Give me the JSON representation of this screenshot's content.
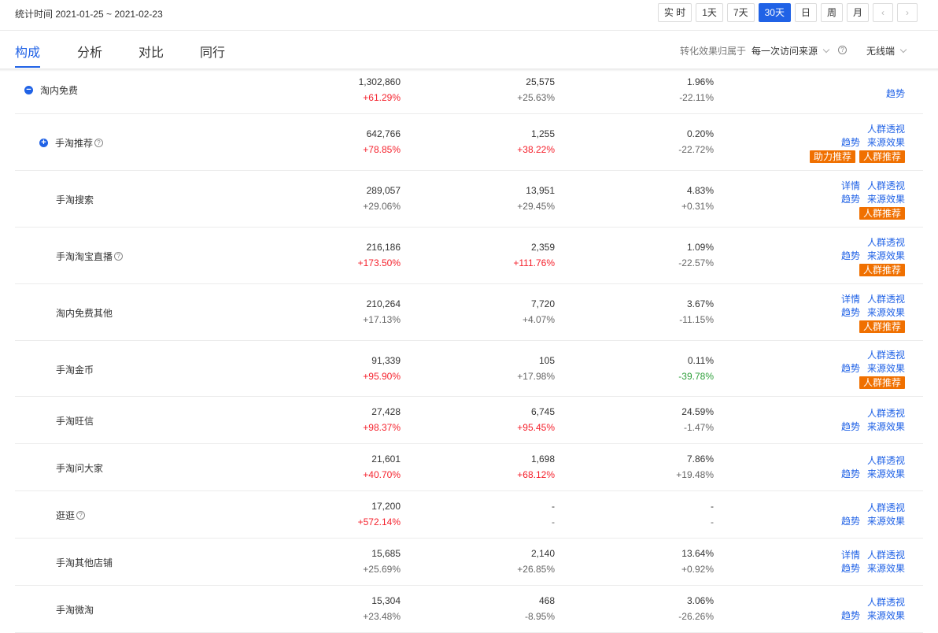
{
  "header": {
    "stat_time": "统计时间 2021-01-25 ~ 2021-02-23",
    "periods": [
      "实 时",
      "1天",
      "7天",
      "30天",
      "日",
      "周",
      "月"
    ],
    "active_period": "30天",
    "prev_glyph": "‹",
    "next_glyph": "›"
  },
  "tabs": [
    {
      "label": "构成",
      "active": true
    },
    {
      "label": "分析",
      "active": false
    },
    {
      "label": "对比",
      "active": false
    },
    {
      "label": "同行",
      "active": false
    }
  ],
  "filters": {
    "attribution_label": "转化效果归属于",
    "attribution_value": "每一次访问来源",
    "device_value": "无线端"
  },
  "colors": {
    "accent": "#2062e6",
    "badge": "#f07000",
    "up": "#f5222d",
    "down": "#2e9f3a"
  },
  "rows": [
    {
      "name": "淘内免费",
      "icon": "minus",
      "help": false,
      "level": 0,
      "c1": {
        "v": "1,302,860",
        "c": "+61.29%",
        "t": "up"
      },
      "c2": {
        "v": "25,575",
        "c": "+25.63%",
        "t": "neutral"
      },
      "c3": {
        "v": "1.96%",
        "c": "-22.11%",
        "t": "neutral"
      },
      "links": [
        [
          "趋势"
        ]
      ],
      "badges": []
    },
    {
      "name": "手淘推荐",
      "icon": "plus",
      "help": true,
      "level": 1,
      "c1": {
        "v": "642,766",
        "c": "+78.85%",
        "t": "up"
      },
      "c2": {
        "v": "1,255",
        "c": "+38.22%",
        "t": "up"
      },
      "c3": {
        "v": "0.20%",
        "c": "-22.72%",
        "t": "neutral"
      },
      "links": [
        [
          "人群透视"
        ],
        [
          "趋势",
          "来源效果"
        ]
      ],
      "badges": [
        "助力推荐",
        "人群推荐"
      ]
    },
    {
      "name": "手淘搜索",
      "icon": "",
      "help": false,
      "level": 2,
      "c1": {
        "v": "289,057",
        "c": "+29.06%",
        "t": "neutral"
      },
      "c2": {
        "v": "13,951",
        "c": "+29.45%",
        "t": "neutral"
      },
      "c3": {
        "v": "4.83%",
        "c": "+0.31%",
        "t": "neutral"
      },
      "links": [
        [
          "详情",
          "人群透视"
        ],
        [
          "趋势",
          "来源效果"
        ]
      ],
      "badges": [
        "人群推荐"
      ]
    },
    {
      "name": "手淘淘宝直播",
      "icon": "",
      "help": true,
      "level": 2,
      "c1": {
        "v": "216,186",
        "c": "+173.50%",
        "t": "up"
      },
      "c2": {
        "v": "2,359",
        "c": "+111.76%",
        "t": "up"
      },
      "c3": {
        "v": "1.09%",
        "c": "-22.57%",
        "t": "neutral"
      },
      "links": [
        [
          "人群透视"
        ],
        [
          "趋势",
          "来源效果"
        ]
      ],
      "badges": [
        "人群推荐"
      ]
    },
    {
      "name": "淘内免费其他",
      "icon": "",
      "help": false,
      "level": 2,
      "c1": {
        "v": "210,264",
        "c": "+17.13%",
        "t": "neutral"
      },
      "c2": {
        "v": "7,720",
        "c": "+4.07%",
        "t": "neutral"
      },
      "c3": {
        "v": "3.67%",
        "c": "-11.15%",
        "t": "neutral"
      },
      "links": [
        [
          "详情",
          "人群透视"
        ],
        [
          "趋势",
          "来源效果"
        ]
      ],
      "badges": [
        "人群推荐"
      ]
    },
    {
      "name": "手淘金币",
      "icon": "",
      "help": false,
      "level": 2,
      "c1": {
        "v": "91,339",
        "c": "+95.90%",
        "t": "up"
      },
      "c2": {
        "v": "105",
        "c": "+17.98%",
        "t": "neutral"
      },
      "c3": {
        "v": "0.11%",
        "c": "-39.78%",
        "t": "down"
      },
      "links": [
        [
          "人群透视"
        ],
        [
          "趋势",
          "来源效果"
        ]
      ],
      "badges": [
        "人群推荐"
      ]
    },
    {
      "name": "手淘旺信",
      "icon": "",
      "help": false,
      "level": 2,
      "c1": {
        "v": "27,428",
        "c": "+98.37%",
        "t": "up"
      },
      "c2": {
        "v": "6,745",
        "c": "+95.45%",
        "t": "up"
      },
      "c3": {
        "v": "24.59%",
        "c": "-1.47%",
        "t": "neutral"
      },
      "links": [
        [
          "人群透视"
        ],
        [
          "趋势",
          "来源效果"
        ]
      ],
      "badges": []
    },
    {
      "name": "手淘问大家",
      "icon": "",
      "help": false,
      "level": 2,
      "c1": {
        "v": "21,601",
        "c": "+40.70%",
        "t": "up"
      },
      "c2": {
        "v": "1,698",
        "c": "+68.12%",
        "t": "up"
      },
      "c3": {
        "v": "7.86%",
        "c": "+19.48%",
        "t": "neutral"
      },
      "links": [
        [
          "人群透视"
        ],
        [
          "趋势",
          "来源效果"
        ]
      ],
      "badges": []
    },
    {
      "name": "逛逛",
      "icon": "",
      "help": true,
      "level": 2,
      "c1": {
        "v": "17,200",
        "c": "+572.14%",
        "t": "up"
      },
      "c2": {
        "v": "-",
        "c": "-",
        "t": "neutral"
      },
      "c3": {
        "v": "-",
        "c": "-",
        "t": "neutral"
      },
      "links": [
        [
          "人群透视"
        ],
        [
          "趋势",
          "来源效果"
        ]
      ],
      "badges": []
    },
    {
      "name": "手淘其他店铺",
      "icon": "",
      "help": false,
      "level": 2,
      "c1": {
        "v": "15,685",
        "c": "+25.69%",
        "t": "neutral"
      },
      "c2": {
        "v": "2,140",
        "c": "+26.85%",
        "t": "neutral"
      },
      "c3": {
        "v": "13.64%",
        "c": "+0.92%",
        "t": "neutral"
      },
      "links": [
        [
          "详情",
          "人群透视"
        ],
        [
          "趋势",
          "来源效果"
        ]
      ],
      "badges": []
    },
    {
      "name": "手淘微淘",
      "icon": "",
      "help": false,
      "level": 2,
      "c1": {
        "v": "15,304",
        "c": "+23.48%",
        "t": "neutral"
      },
      "c2": {
        "v": "468",
        "c": "-8.95%",
        "t": "neutral"
      },
      "c3": {
        "v": "3.06%",
        "c": "-26.26%",
        "t": "neutral"
      },
      "links": [
        [
          "人群透视"
        ],
        [
          "趋势",
          "来源效果"
        ]
      ],
      "badges": []
    }
  ]
}
